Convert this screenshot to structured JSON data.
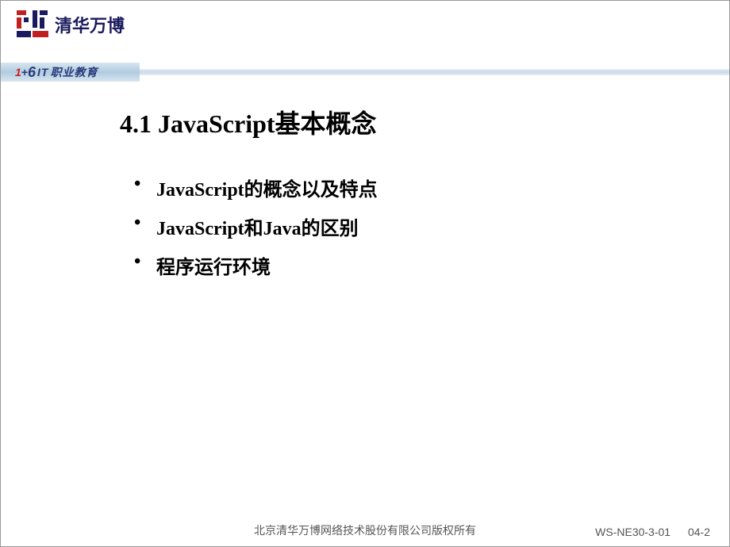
{
  "header": {
    "logo_text": "清华万博",
    "subtitle_prefix_1": "1",
    "subtitle_prefix_plus": "+",
    "subtitle_prefix_6": "6",
    "subtitle_it": "IT",
    "subtitle_cn": "职业教育"
  },
  "content": {
    "title": "4.1 JavaScript基本概念",
    "bullets": [
      "JavaScript的概念以及特点",
      "JavaScript和Java的区别",
      "程序运行环境"
    ]
  },
  "footer": {
    "copyright": "北京清华万博网络技术股份有限公司版权所有",
    "code": "WS-NE30-3-01",
    "page": "04-2"
  }
}
